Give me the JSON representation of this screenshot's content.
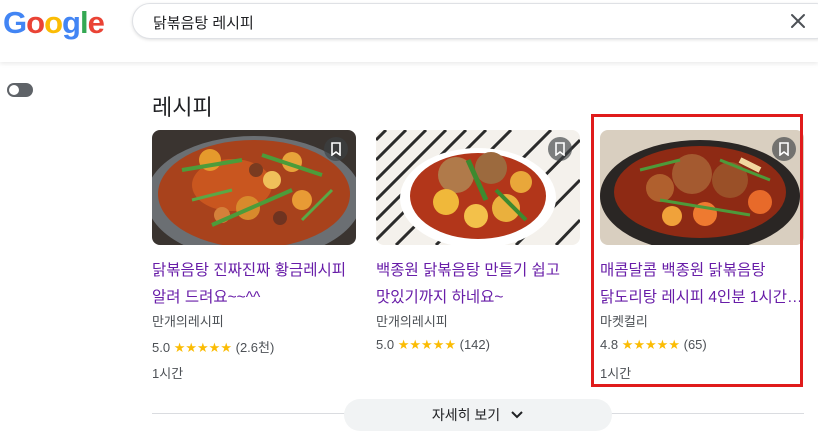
{
  "logo": {
    "text": "Google"
  },
  "search": {
    "query": "닭볶음탕 레시피"
  },
  "section": {
    "title": "레시피"
  },
  "cards": [
    {
      "title": "닭볶음탕 진짜진짜 황금레시피 알려 드려요~~^^",
      "source": "만개의레시피",
      "rating": "5.0",
      "star_count": 5,
      "reviews": "(2.6천)",
      "time": "1시간"
    },
    {
      "title": "백종원 닭볶음탕 만들기 쉽고 맛있기까지 하네요~",
      "source": "만개의레시피",
      "rating": "5.0",
      "star_count": 5,
      "reviews": "(142)",
      "time": ""
    },
    {
      "title": "매콤달콤 백종원 닭볶음탕 닭도리탕 레시피 4인분 1시간 …",
      "source": "마켓컬리",
      "rating": "4.8",
      "star_count": 5,
      "reviews": "(65)",
      "time": "1시간"
    }
  ],
  "more_button": {
    "label": "자세히 보기"
  },
  "colors": {
    "link_visited": "#681da8",
    "star": "#fbbc04",
    "highlight": "#e01b1b"
  }
}
